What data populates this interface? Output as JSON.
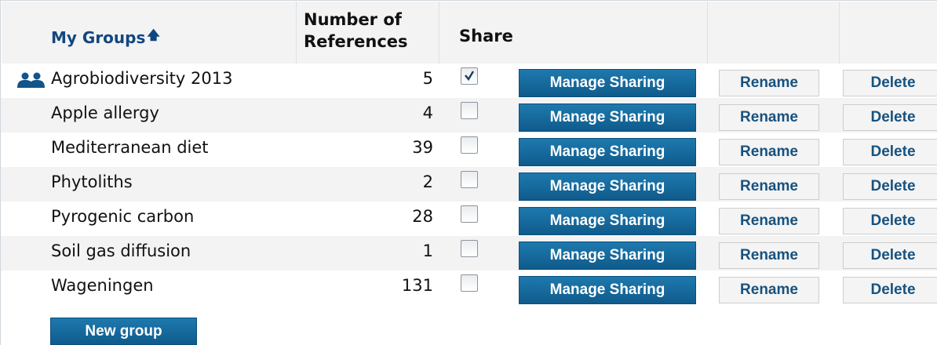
{
  "header": {
    "groups_label": "My Groups",
    "sort_icon": "up-arrow-icon",
    "number_label_line1": "Number of",
    "number_label_line2": "References",
    "share_label": "Share"
  },
  "colors": {
    "primary_button": "#156b9e",
    "link": "#11477f",
    "row_alt": "#f3f3f3"
  },
  "rows": [
    {
      "name": "Agrobiodiversity 2013",
      "count": "5",
      "shared": true,
      "shared_icon": "group-people-icon",
      "manage_label": "Manage Sharing",
      "rename_label": "Rename",
      "delete_label": "Delete"
    },
    {
      "name": "Apple allergy",
      "count": "4",
      "shared": false,
      "manage_label": "Manage Sharing",
      "rename_label": "Rename",
      "delete_label": "Delete"
    },
    {
      "name": "Mediterranean diet",
      "count": "39",
      "shared": false,
      "manage_label": "Manage Sharing",
      "rename_label": "Rename",
      "delete_label": "Delete"
    },
    {
      "name": "Phytoliths",
      "count": "2",
      "shared": false,
      "manage_label": "Manage Sharing",
      "rename_label": "Rename",
      "delete_label": "Delete"
    },
    {
      "name": "Pyrogenic carbon",
      "count": "28",
      "shared": false,
      "manage_label": "Manage Sharing",
      "rename_label": "Rename",
      "delete_label": "Delete"
    },
    {
      "name": "Soil gas diffusion",
      "count": "1",
      "shared": false,
      "manage_label": "Manage Sharing",
      "rename_label": "Rename",
      "delete_label": "Delete"
    },
    {
      "name": "Wageningen",
      "count": "131",
      "shared": false,
      "manage_label": "Manage Sharing",
      "rename_label": "Rename",
      "delete_label": "Delete"
    }
  ],
  "footer": {
    "new_group_label": "New group"
  }
}
